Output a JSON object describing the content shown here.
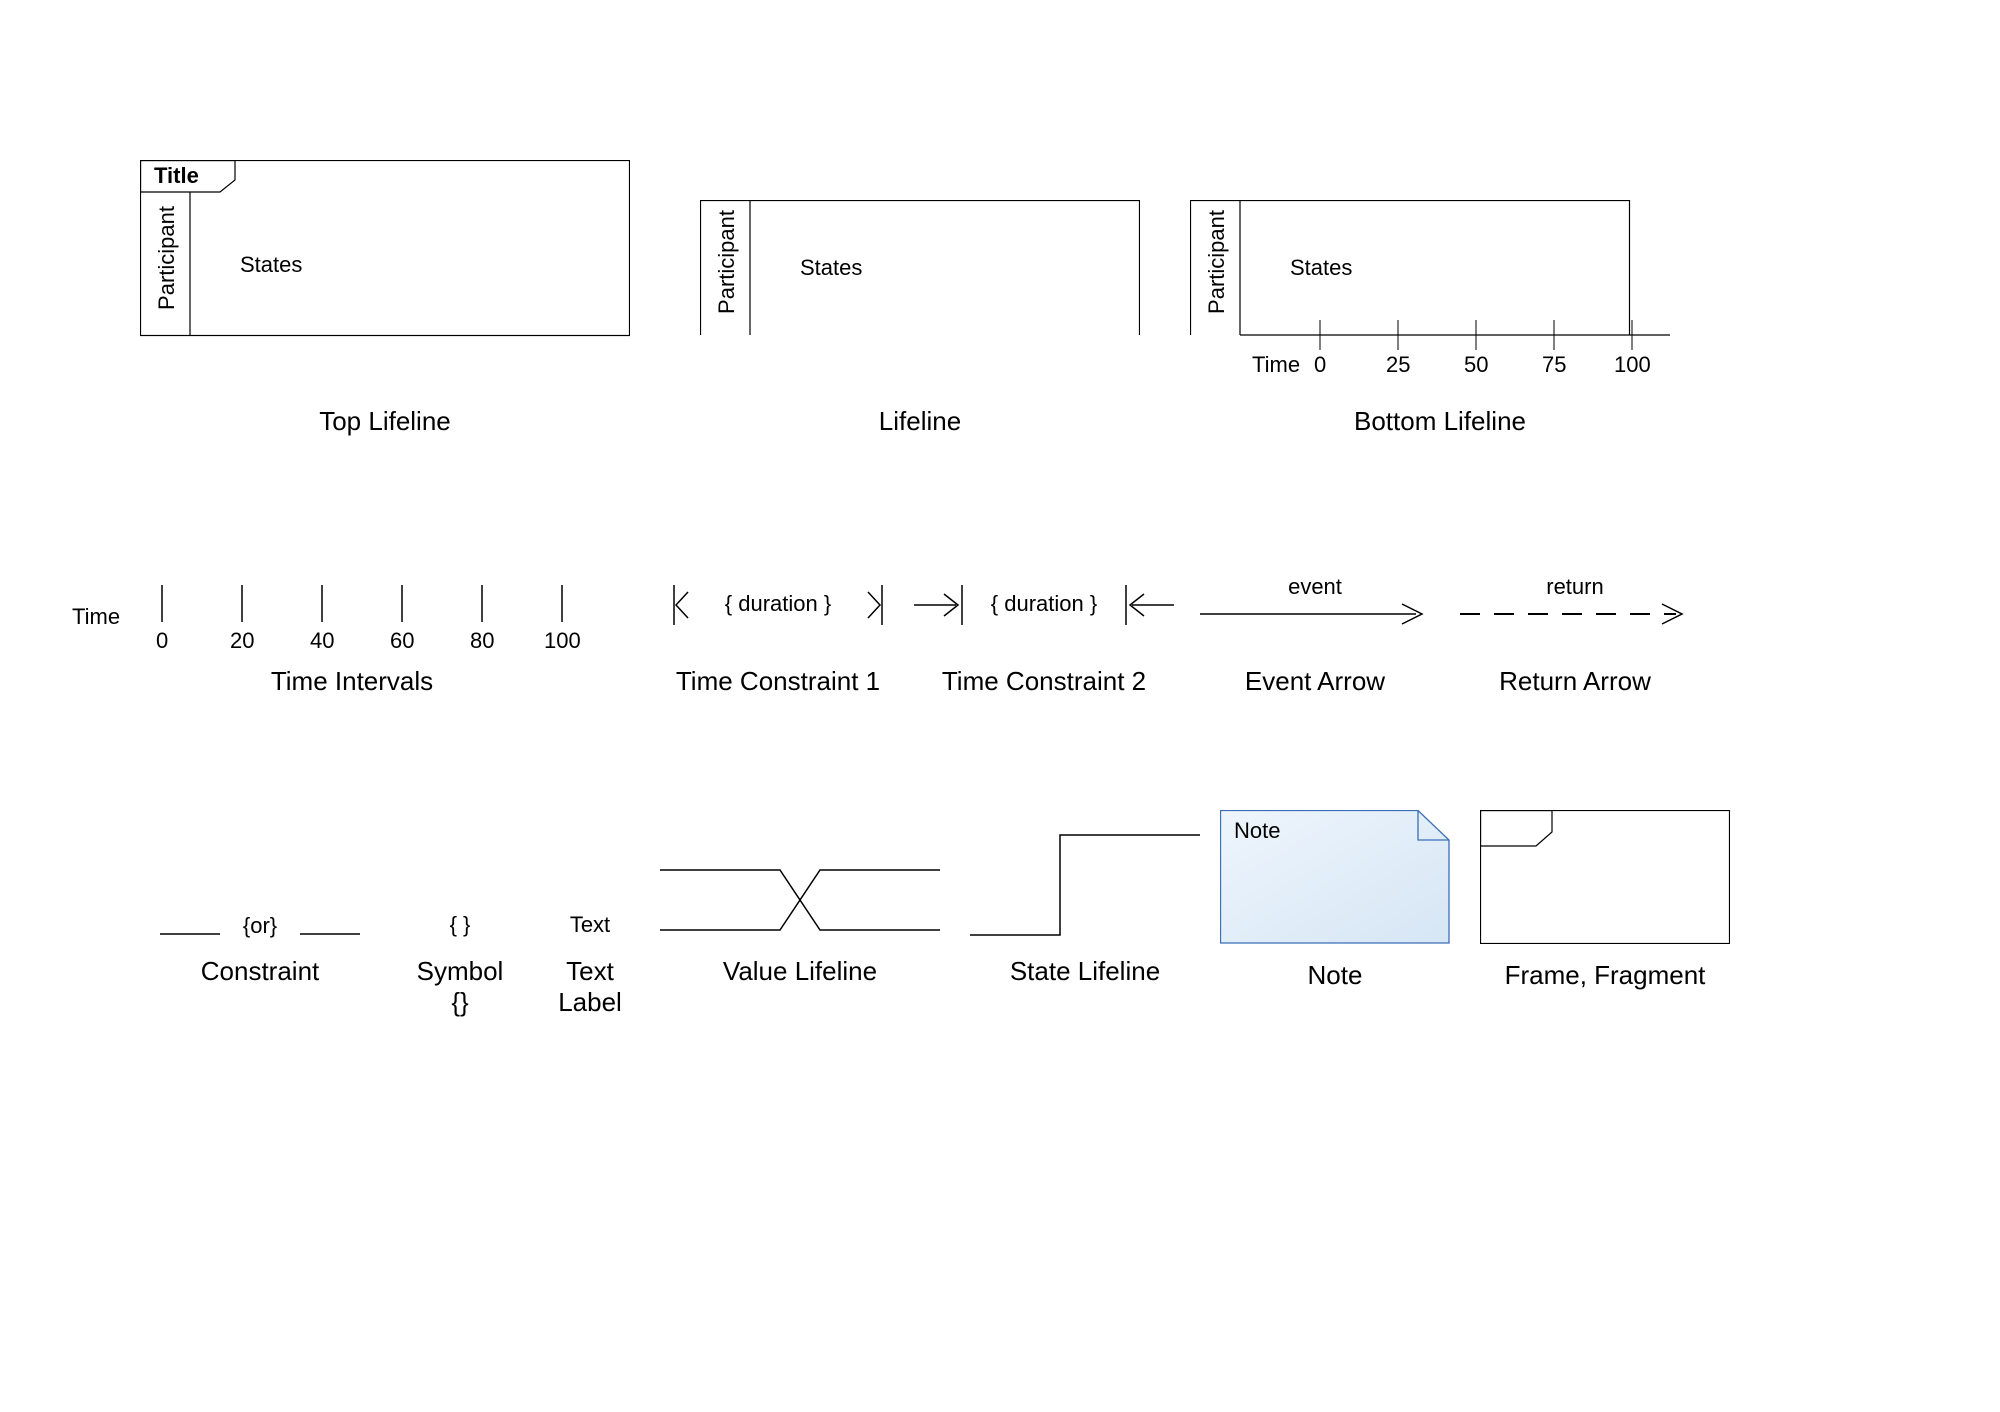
{
  "row1": {
    "top_lifeline": {
      "title": "Title",
      "participant": "Participant",
      "states": "States",
      "caption": "Top Lifeline"
    },
    "lifeline": {
      "participant": "Participant",
      "states": "States",
      "caption": "Lifeline"
    },
    "bottom_lifeline": {
      "participant": "Participant",
      "states": "States",
      "time": "Time",
      "ticks": [
        "0",
        "25",
        "50",
        "75",
        "100"
      ],
      "caption": "Bottom Lifeline"
    }
  },
  "row2": {
    "time_intervals": {
      "time": "Time",
      "ticks": [
        "0",
        "20",
        "40",
        "60",
        "80",
        "100"
      ],
      "caption": "Time Intervals"
    },
    "time_constraint1": {
      "label": "{ duration }",
      "caption": "Time Constraint 1"
    },
    "time_constraint2": {
      "label": "{ duration }",
      "caption": "Time Constraint 2"
    },
    "event_arrow": {
      "label": "event",
      "caption": "Event Arrow"
    },
    "return_arrow": {
      "label": "return",
      "caption": "Return Arrow"
    }
  },
  "row3": {
    "constraint": {
      "label": "{or}",
      "caption": "Constraint"
    },
    "symbol": {
      "label": "{ }",
      "caption": "Symbol {}"
    },
    "text_label": {
      "label": "Text",
      "caption": "Text Label"
    },
    "value_lifeline": {
      "caption": "Value Lifeline"
    },
    "state_lifeline": {
      "caption": "State Lifeline"
    },
    "note": {
      "label": "Note",
      "caption": "Note"
    },
    "frame": {
      "caption": "Frame, Fragment"
    }
  }
}
